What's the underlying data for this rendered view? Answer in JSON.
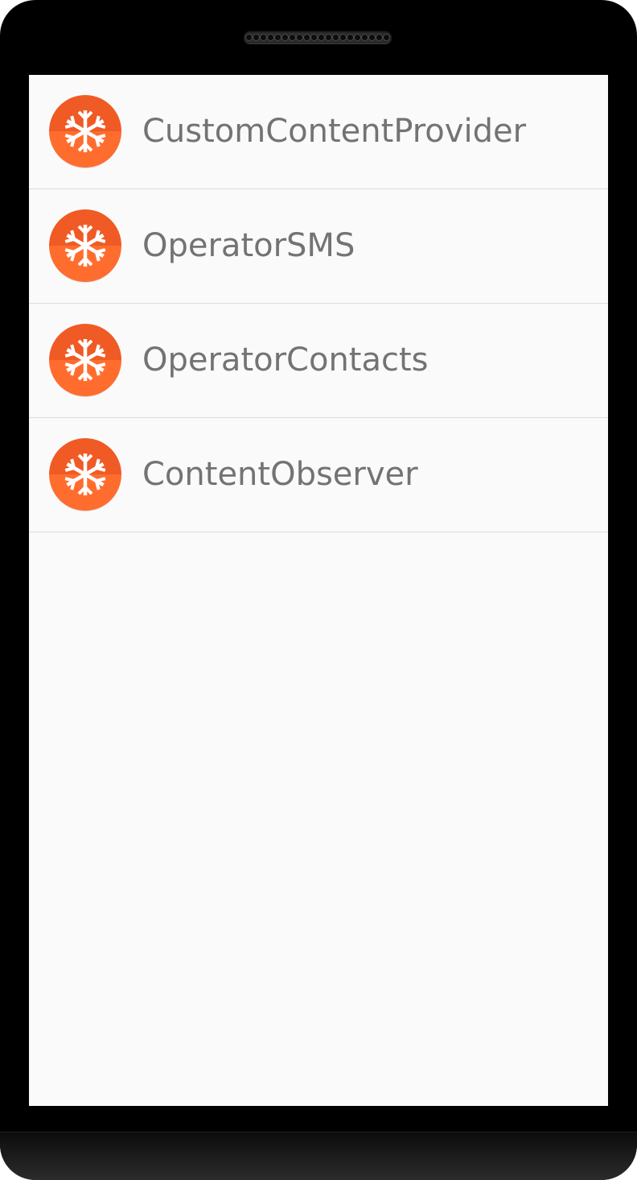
{
  "app": {
    "items": [
      {
        "label": "CustomContentProvider",
        "icon": "snowflake-icon"
      },
      {
        "label": "OperatorSMS",
        "icon": "snowflake-icon"
      },
      {
        "label": "OperatorContacts",
        "icon": "snowflake-icon"
      },
      {
        "label": "ContentObserver",
        "icon": "snowflake-icon"
      }
    ]
  },
  "colors": {
    "icon_orange": "#f05a24",
    "icon_orange_light": "#ff6d2e",
    "label_text": "#737373",
    "screen_bg": "#fafafa",
    "divider": "#dcdcdc"
  }
}
